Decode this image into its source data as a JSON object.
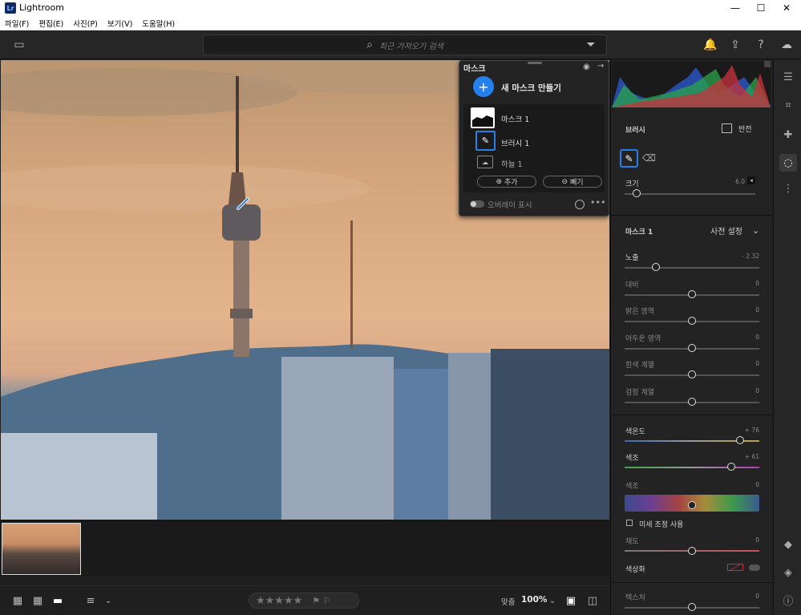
{
  "window": {
    "app_icon": "Lr",
    "title": "Lightroom",
    "minimize": "—",
    "maximize": "☐",
    "close": "✕"
  },
  "menu": [
    "파일(F)",
    "편집(E)",
    "사진(P)",
    "보기(V)",
    "도움말(H)"
  ],
  "toolbar": {
    "search_placeholder": "최근 가져오기 검색",
    "search_icon": "⌕",
    "filter_icon": "⏷",
    "bell_icon": "🔔",
    "share_icon": "⇪",
    "help_icon": "?",
    "cloud_icon": "☁",
    "panel_toggle_icon": "▭"
  },
  "mask_panel": {
    "title": "마스크",
    "new_mask_icon": "+",
    "new_mask": "새 마스크 만들기",
    "items": [
      {
        "label": "마스크 1"
      },
      {
        "label": "브러시 1"
      },
      {
        "label": "하늘 1"
      }
    ],
    "add_button": "추가",
    "subtract_button": "빼기",
    "overlay_label": "오버레이 표시"
  },
  "right_panel": {
    "brush": {
      "title": "브러시",
      "invert_label": "반전",
      "size_label": "크기",
      "size_value": "6.0"
    },
    "mask_section": {
      "title": "마스크 1",
      "preset_label": "사전 설정"
    },
    "sliders": [
      {
        "label": "노출",
        "value": "- 2.32",
        "level": 0.23
      },
      {
        "label": "대비",
        "value": "0",
        "level": 0.5
      },
      {
        "label": "밝은 영역",
        "value": "0",
        "level": 0.5
      },
      {
        "label": "어두운 영역",
        "value": "0",
        "level": 0.5
      },
      {
        "label": "흰색 계열",
        "value": "0",
        "level": 0.5
      },
      {
        "label": "검정 계열",
        "value": "0",
        "level": 0.5
      }
    ],
    "color": [
      {
        "label": "색온도",
        "value": "+ 76",
        "level": 0.86
      },
      {
        "label": "색조",
        "value": "+ 61",
        "level": 0.79
      },
      {
        "label": "색조",
        "value": "0",
        "level": 0.5
      }
    ],
    "fine_adjust_label": "미세 조정 사용",
    "saturation": {
      "label": "채도",
      "value": "0",
      "level": 0.5
    },
    "colorize_label": "색상화",
    "texture": {
      "label": "텍스처",
      "value": "0",
      "level": 0.5
    }
  },
  "bottom": {
    "zoom_label": "맞춤",
    "zoom_value": "100%",
    "stars": "★★★★★",
    "flags": "⚑ ⚐"
  },
  "accent_color": "#2680eb"
}
